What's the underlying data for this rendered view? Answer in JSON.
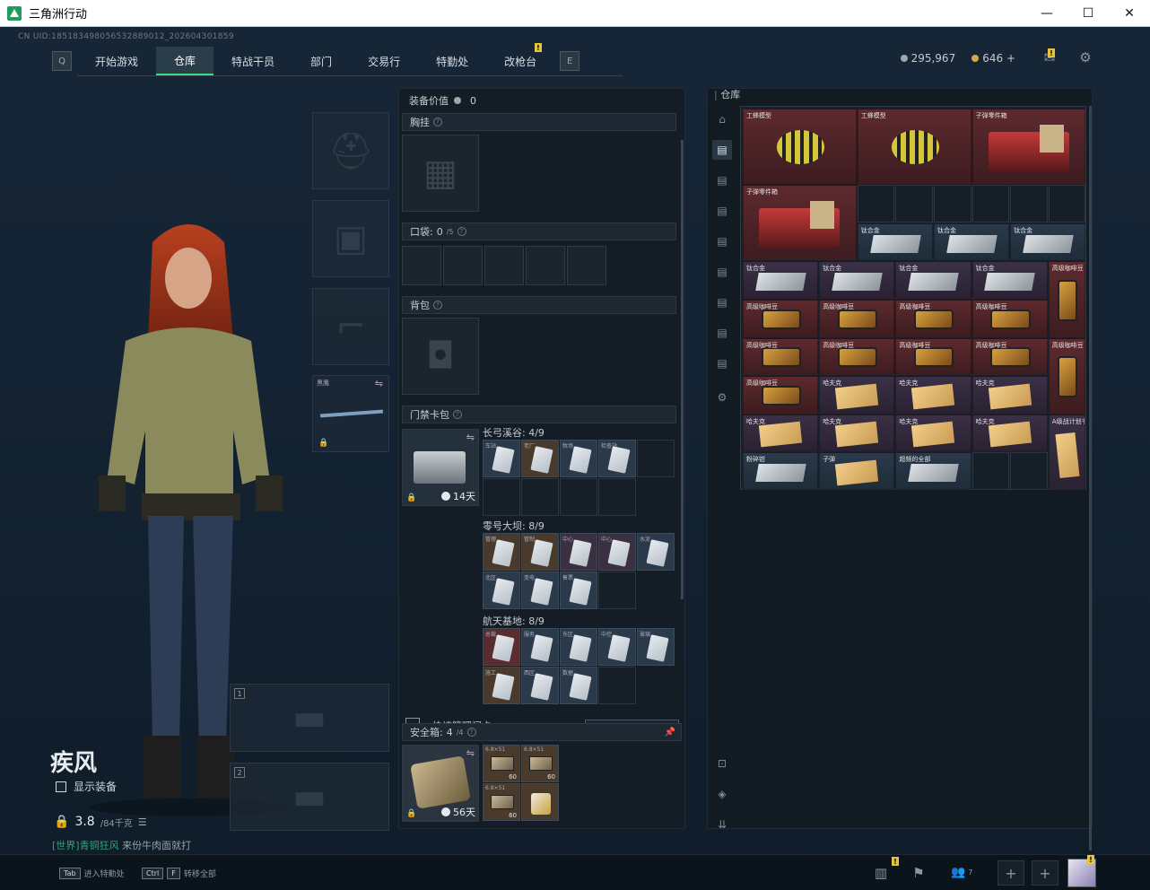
{
  "window": {
    "title": "三角洲行动",
    "min": "—",
    "max": "☐",
    "close": "✕"
  },
  "uid": "CN UID:1851834980565328890​12_2026043018​59",
  "nav": {
    "tabs": [
      "开始游戏",
      "仓库",
      "特战干员",
      "部门",
      "交易行",
      "特勤处",
      "改枪台"
    ],
    "active": 1,
    "left_key": "Q",
    "right_key": "E"
  },
  "currency": {
    "silver": "295,967",
    "gold": "646",
    "plus": "+"
  },
  "icons": {
    "mail": "mail-icon",
    "settings": "gear-icon"
  },
  "operator": {
    "name": "疾风",
    "show_equipment": "显示装备",
    "weight": "3.8",
    "weight_max": "/84千克",
    "chat_tag": "[世界]青铜狂风",
    "chat_text": "来份牛肉面就打"
  },
  "equip": {
    "value_label": "装备价值",
    "value": "0",
    "chest": "胸挂",
    "pocket": "口袋:",
    "pocket_count": "0",
    "pocket_max": "/5",
    "backpack": "背包",
    "keycard_bag": "门禁卡包",
    "melee_label": "黑鹰"
  },
  "keycards": {
    "bag_timer": "14天",
    "groups": [
      {
        "title": "长弓溪谷: 4/9",
        "cards": [
          "车站",
          "老厂",
          "牧场",
          "检查站"
        ]
      },
      {
        "title": "零号大坝: 8/9",
        "cards": [
          "管理",
          "管制",
          "中心",
          "中心",
          "水泥",
          "北区",
          "变电",
          "售票"
        ]
      },
      {
        "title": "航天基地: 8/9",
        "cards": [
          "总裁",
          "服务",
          "东区",
          "中控",
          "玻璃",
          "施工",
          "西区",
          "数据"
        ]
      }
    ]
  },
  "quick_manage": {
    "label": "快捷管理门卡",
    "button": "管理"
  },
  "safebox": {
    "label": "安全箱:",
    "count": "4",
    "max": "/4",
    "timer": "56天",
    "items": [
      {
        "label": "6.8×51",
        "count": "60"
      },
      {
        "label": "6.8×51",
        "count": "60"
      },
      {
        "label": "6.8×51",
        "count": "60"
      },
      {
        "label": "",
        "count": ""
      }
    ]
  },
  "stash": {
    "title": "仓库",
    "items": [
      {
        "label": "工蜂模型"
      },
      {
        "label": "工蜂模型"
      },
      {
        "label": "子弹零件箱"
      },
      {
        "label": "子弹零件箱"
      },
      {
        "label": "钛合金"
      },
      {
        "label": "钛合金"
      },
      {
        "label": "钛合金"
      },
      {
        "label": "钛合金"
      },
      {
        "label": "钛合金"
      },
      {
        "label": "钛合金"
      },
      {
        "label": "钛合金"
      },
      {
        "label": "高级咖啡豆"
      },
      {
        "label": "高级咖啡豆"
      },
      {
        "label": "高级咖啡豆"
      },
      {
        "label": "高级咖啡豆"
      },
      {
        "label": "高级咖啡豆"
      },
      {
        "label": "高级咖啡豆"
      },
      {
        "label": "高级咖啡豆"
      },
      {
        "label": "高级咖啡豆"
      },
      {
        "label": "高级咖啡豆"
      },
      {
        "label": "高级咖啡豆"
      },
      {
        "label": "高级咖啡豆"
      },
      {
        "label": "哈夫克"
      },
      {
        "label": "哈夫克"
      },
      {
        "label": "哈夫克"
      },
      {
        "label": "哈夫克"
      },
      {
        "label": "哈夫克"
      },
      {
        "label": "哈夫克"
      },
      {
        "label": "哈夫克"
      },
      {
        "label": "A级战计划书"
      },
      {
        "label": "粉碎钳"
      },
      {
        "label": "子弹"
      },
      {
        "label": "超频的全部"
      }
    ]
  },
  "bottom": {
    "hint1_key": "Tab",
    "hint1": "进入特勤处",
    "hint2_key": "Ctrl",
    "hint2_key2": "F",
    "hint2": "转移全部",
    "squad_count": "7",
    "plus": "+"
  }
}
